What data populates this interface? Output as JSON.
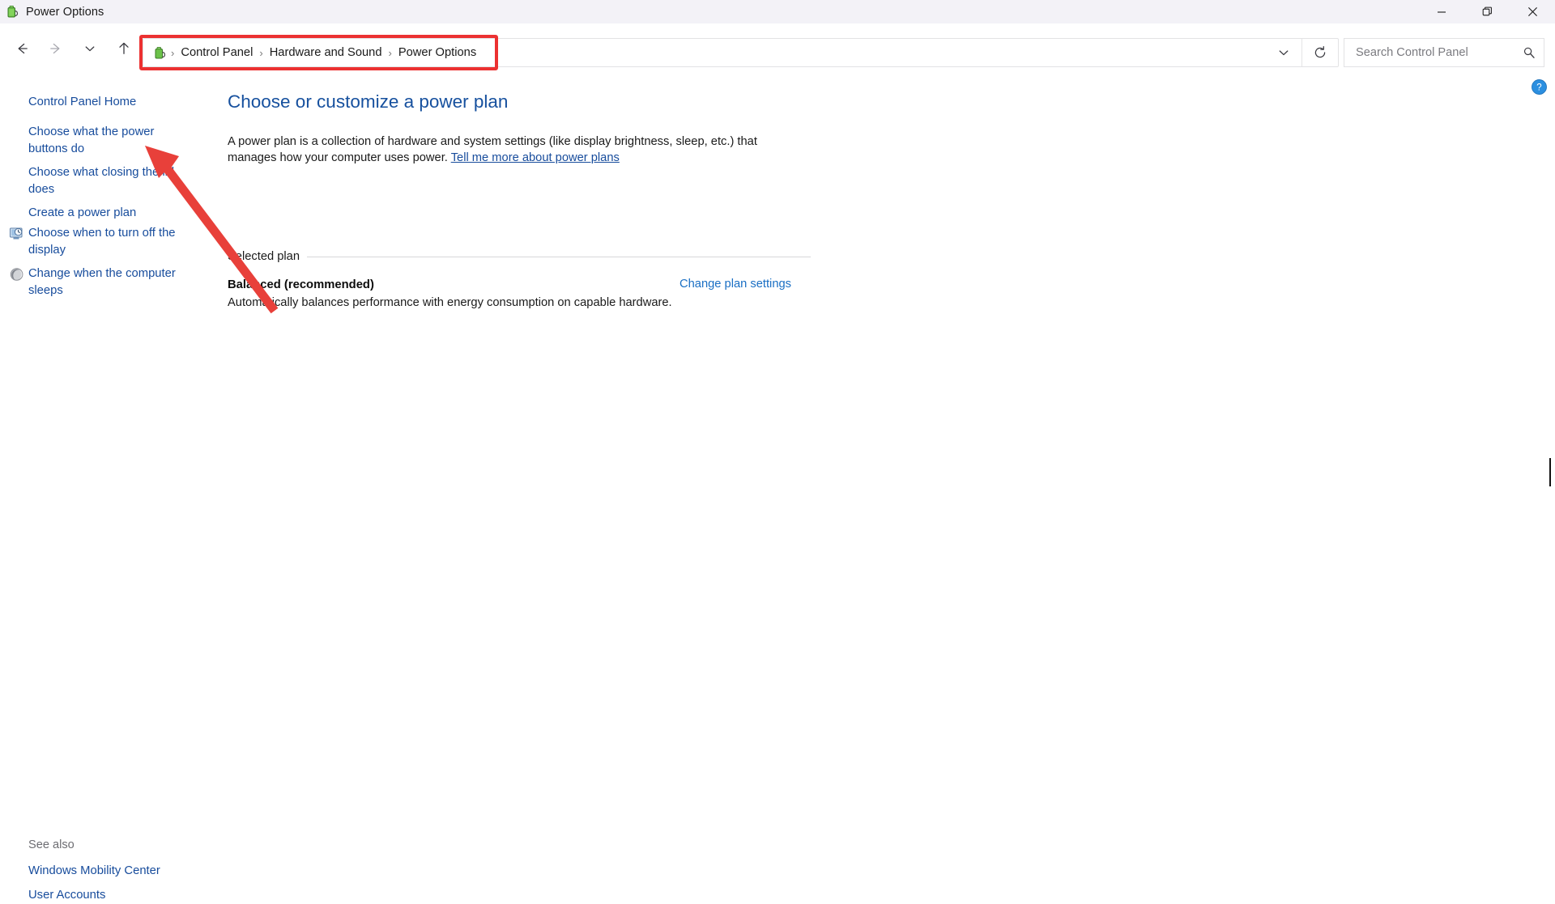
{
  "window": {
    "title": "Power Options",
    "icon": "battery-icon",
    "controls": {
      "minimize": "minimize-icon",
      "restore": "restore-icon",
      "close": "close-icon"
    }
  },
  "toolbar": {
    "back": "back-arrow-icon",
    "forward": "forward-arrow-icon",
    "recent": "chevron-down-icon",
    "up": "up-arrow-icon",
    "address_chevron": "chevron-down-icon",
    "refresh": "refresh-icon"
  },
  "breadcrumb": {
    "icon": "control-panel-battery-icon",
    "separator": "›",
    "items": [
      "Control Panel",
      "Hardware and Sound",
      "Power Options"
    ],
    "highlight_color": "#ec3131"
  },
  "search": {
    "placeholder": "Search Control Panel",
    "value": "",
    "icon": "search-icon"
  },
  "help": {
    "label": "?",
    "name": "help-button"
  },
  "sidebar": {
    "home_label": "Control Panel Home",
    "items": [
      {
        "label": "Choose what the power buttons do",
        "icon": null
      },
      {
        "label": "Choose what closing the lid does",
        "icon": null
      },
      {
        "label": "Create a power plan",
        "icon": null
      },
      {
        "label": "Choose when to turn off the display",
        "icon": "monitor-clock-icon"
      },
      {
        "label": "Change when the computer sleeps",
        "icon": "sleep-moon-icon"
      }
    ],
    "see_also_label": "See also",
    "see_also": [
      "Windows Mobility Center",
      "User Accounts"
    ]
  },
  "main": {
    "title": "Choose or customize a power plan",
    "intro_text": "A power plan is a collection of hardware and system settings (like display brightness, sleep, etc.) that manages how your computer uses power. ",
    "intro_link": "Tell me more about power plans",
    "group_label": "Selected plan",
    "plan_name": "Balanced (recommended)",
    "plan_description": "Automatically balances performance with energy consumption on capable hardware.",
    "change_plan_link": "Change plan settings"
  },
  "colors": {
    "titlebar_bg": "#f3f2f7",
    "link": "#174c9c",
    "heading": "#16509e",
    "annotation_red": "#e8403a"
  },
  "annotation": {
    "arrow": "red-arrow-pointing-to-choose-what-the-power-buttons-do"
  }
}
